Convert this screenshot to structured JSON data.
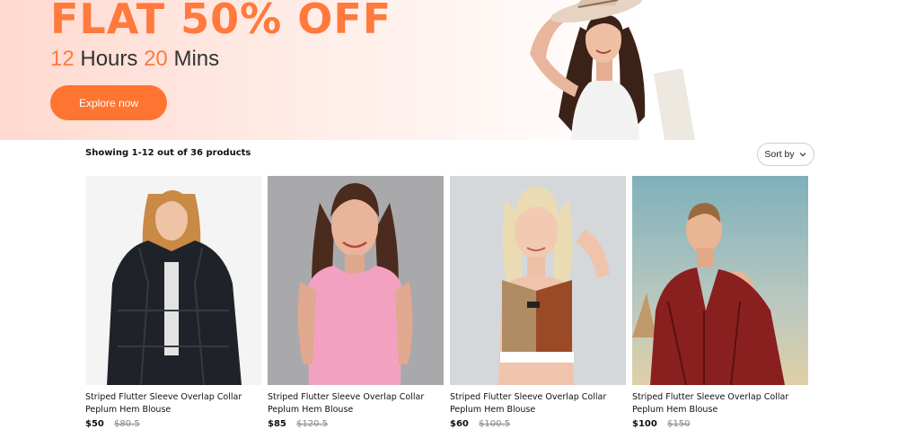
{
  "hero": {
    "headline": "FLAT 50% OFF",
    "countdown": {
      "hours": "12",
      "hours_label": "Hours",
      "mins": "20",
      "mins_label": "Mins"
    },
    "cta_label": "Explore now",
    "accent_color": "#ff7431"
  },
  "toolbar": {
    "showing_text": "Showing 1-12 out of 36 products",
    "sort_label": "Sort by"
  },
  "products": [
    {
      "title": "Striped Flutter Sleeve Overlap Collar Peplum Hem Blouse",
      "price": "$50",
      "old_price": "$80.5",
      "image_icon": "woman-black-fur-jacket"
    },
    {
      "title": "Striped Flutter Sleeve Overlap Collar Peplum Hem Blouse",
      "price": "$85",
      "old_price": "$120.5",
      "image_icon": "woman-pink-top"
    },
    {
      "title": "Striped Flutter Sleeve Overlap Collar Peplum Hem Blouse",
      "price": "$60",
      "old_price": "$100.5",
      "image_icon": "woman-brown-crop-top"
    },
    {
      "title": "Striped Flutter Sleeve Overlap Collar Peplum Hem Blouse",
      "price": "$100",
      "old_price": "$150",
      "image_icon": "woman-red-blouse"
    }
  ]
}
